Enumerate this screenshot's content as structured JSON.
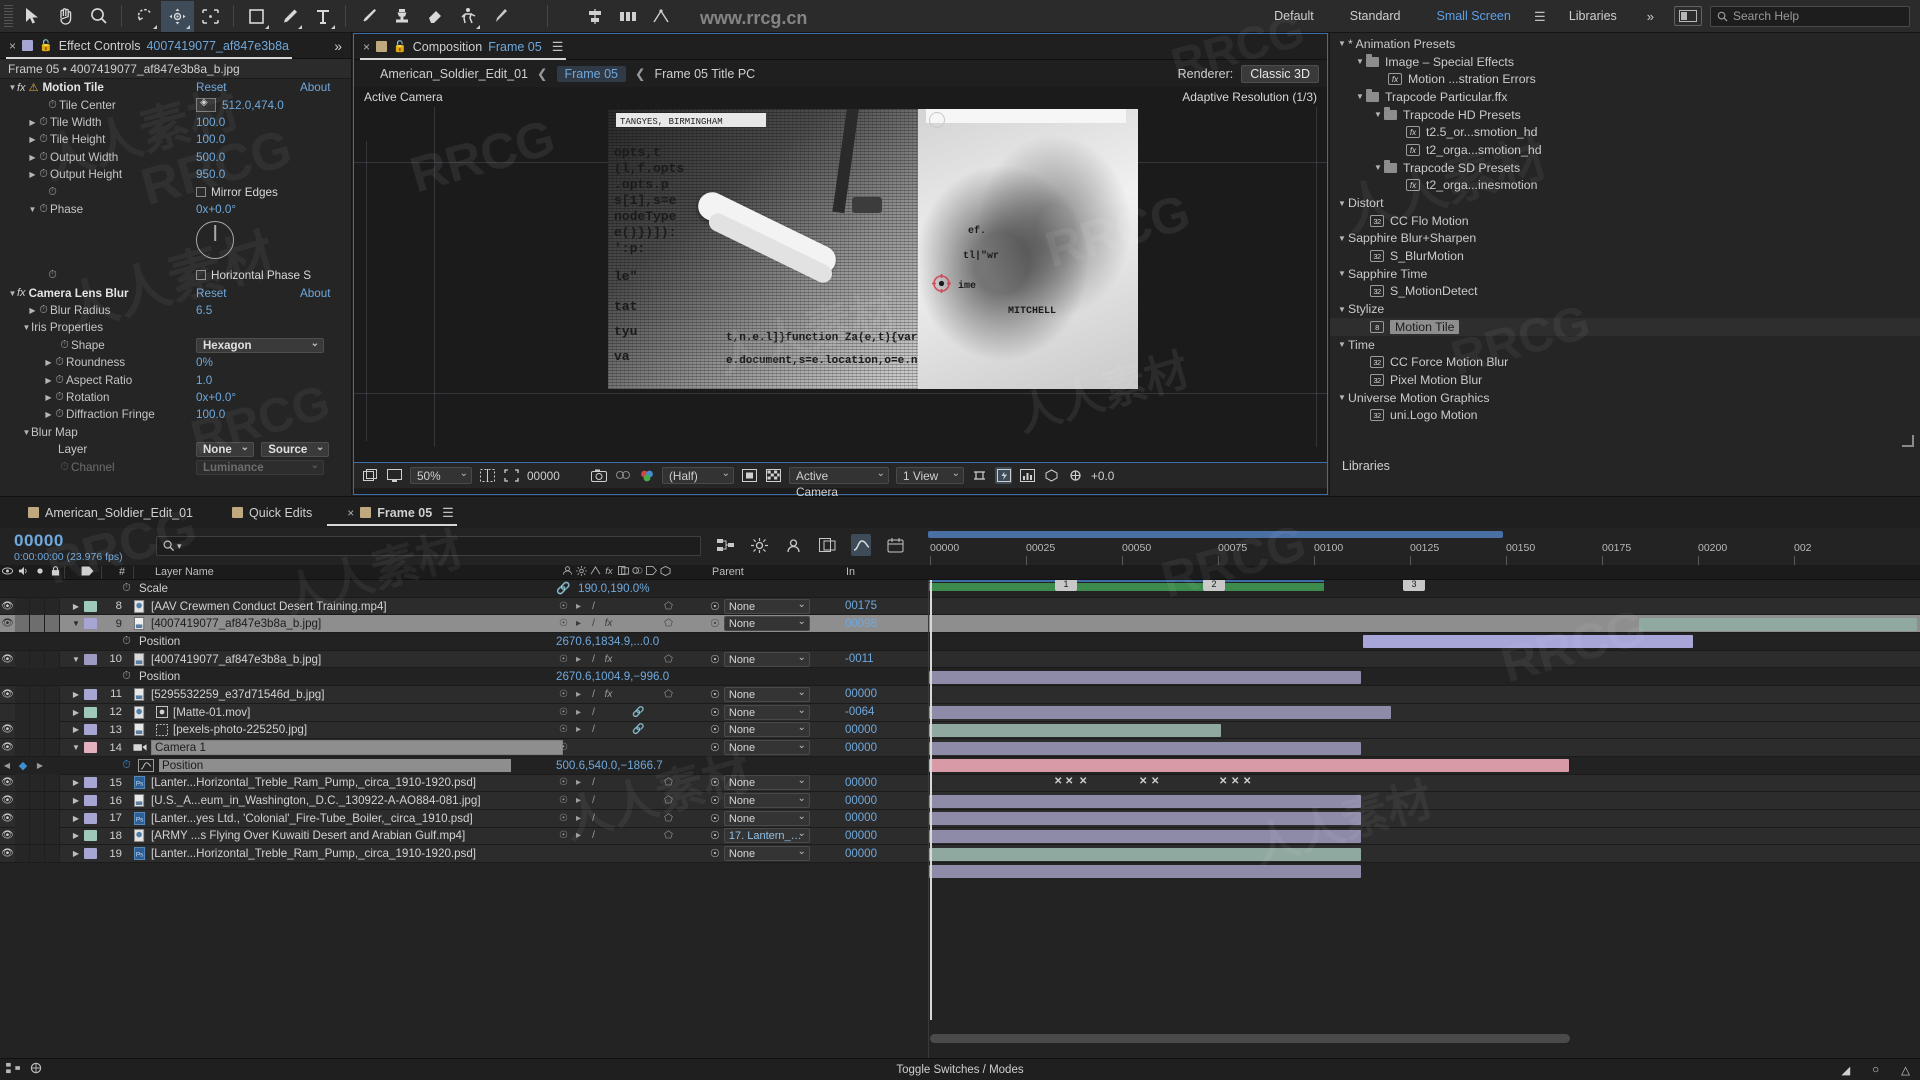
{
  "app": {
    "title": "Adobe After Effects"
  },
  "toolbar": {
    "tools": [
      {
        "name": "selection-tool",
        "label": "Selection",
        "selected": false
      },
      {
        "name": "hand-tool",
        "label": "Hand",
        "selected": false
      },
      {
        "name": "zoom-tool",
        "label": "Zoom",
        "selected": false
      },
      {
        "name": "orbit-tool",
        "label": "Orbit Camera",
        "selected": false
      },
      {
        "name": "unified-camera-tool",
        "label": "Unified Camera",
        "selected": true
      },
      {
        "name": "pan-behind-tool",
        "label": "Pan Behind (Anchor Point)",
        "selected": false
      },
      {
        "name": "rectangle-tool",
        "label": "Rectangle",
        "selected": false
      },
      {
        "name": "pen-tool",
        "label": "Pen",
        "selected": false
      },
      {
        "name": "type-tool",
        "label": "Type",
        "selected": false
      },
      {
        "name": "brush-tool",
        "label": "Brush",
        "selected": false
      },
      {
        "name": "clone-stamp-tool",
        "label": "Clone Stamp",
        "selected": false
      },
      {
        "name": "eraser-tool",
        "label": "Eraser",
        "selected": false
      },
      {
        "name": "roto-brush-tool",
        "label": "Roto Brush",
        "selected": false
      },
      {
        "name": "puppet-pin-tool",
        "label": "Puppet Pin",
        "selected": false
      }
    ],
    "extra_tools": [
      {
        "name": "align-tool",
        "label": "Align"
      },
      {
        "name": "distribute-tool",
        "label": "Distribute"
      },
      {
        "name": "snapping-tool",
        "label": "Snapping"
      }
    ],
    "workspaces": [
      {
        "label": "Default",
        "active": false
      },
      {
        "label": "Standard",
        "active": false
      },
      {
        "label": "Small Screen",
        "active": true
      },
      {
        "label": "Libraries",
        "active": false
      }
    ],
    "overflow_label": "»",
    "search_placeholder": "Search Help"
  },
  "effect_controls": {
    "tab_label": "Effect Controls",
    "tab_value": "4007419077_af847e3b8a",
    "overflow": "»",
    "header": "Frame 05  •  4007419077_af847e3b8a_b.jpg",
    "effects": [
      {
        "name": "Motion Tile",
        "reset": "Reset",
        "about": "About",
        "properties": [
          {
            "label": "Tile Center",
            "value": "512.0,474.0",
            "kind": "point"
          },
          {
            "label": "Tile Width",
            "value": "100.0",
            "kind": "number"
          },
          {
            "label": "Tile Height",
            "value": "100.0",
            "kind": "number"
          },
          {
            "label": "Output Width",
            "value": "500.0",
            "kind": "number"
          },
          {
            "label": "Output Height",
            "value": "950.0",
            "kind": "number"
          },
          {
            "label": "",
            "value": "Mirror Edges",
            "kind": "checkbox"
          },
          {
            "label": "Phase",
            "value": "0x+0.0°",
            "kind": "angle"
          },
          {
            "label": "",
            "value": "Horizontal Phase S",
            "kind": "checkbox"
          }
        ]
      },
      {
        "name": "Camera Lens Blur",
        "reset": "Reset",
        "about": "About",
        "properties": [
          {
            "label": "Blur Radius",
            "value": "6.5",
            "kind": "number"
          },
          {
            "label": "Iris Properties",
            "value": "",
            "kind": "group"
          },
          {
            "label": "Shape",
            "value": "Hexagon",
            "kind": "dropdown"
          },
          {
            "label": "Roundness",
            "value": "0%",
            "kind": "number"
          },
          {
            "label": "Aspect Ratio",
            "value": "1.0",
            "kind": "number"
          },
          {
            "label": "Rotation",
            "value": "0x+0.0°",
            "kind": "angle"
          },
          {
            "label": "Diffraction Fringe",
            "value": "100.0",
            "kind": "number"
          },
          {
            "label": "Blur Map",
            "value": "",
            "kind": "group"
          },
          {
            "label": "Layer",
            "value": "None",
            "value2": "Source",
            "kind": "layer-dropdown"
          },
          {
            "label": "Channel",
            "value": "Luminance",
            "kind": "dropdown-disabled"
          }
        ]
      }
    ]
  },
  "composition": {
    "tab_close": "×",
    "tab_prefix": "Composition",
    "tab_name": "Frame 05",
    "breadcrumbs": [
      {
        "label": "American_Soldier_Edit_01",
        "active": false
      },
      {
        "label": "Frame 05",
        "active": true
      },
      {
        "label": "Frame 05 Title PC",
        "active": false
      }
    ],
    "renderer_label": "Renderer:",
    "renderer_value": "Classic 3D",
    "active_camera": "Active Camera",
    "adaptive_resolution": "Adaptive Resolution (1/3)",
    "viewer": {
      "magnification": "50%",
      "timecode": "00000",
      "resolution": "(Half)",
      "view_camera": "Active Camera",
      "view_layout": "1 View",
      "exposure": "+0.0"
    },
    "image_text": {
      "top_label": "TANGYES, BIRMINGHAM",
      "bottom_label": "MITCHELL",
      "code_lines": [
        "opts,t",
        "(l,f.opts",
        ".opts.p",
        "s[1],s=e",
        "nodeType",
        "e()})]):",
        "':p:",
        "le\":",
        "tat",
        "tyu",
        "va"
      ],
      "code_lines_bottom": [
        "t,n.e.l]}function Za(e,t){var n",
        "e.document,s=e.location,o=e.nav"
      ]
    }
  },
  "effects_presets": {
    "panel_label": "Libraries",
    "tree": [
      {
        "depth": 0,
        "type": "group",
        "label": "* Animation Presets"
      },
      {
        "depth": 1,
        "type": "folder",
        "label": "Image – Special Effects"
      },
      {
        "depth": 2,
        "type": "preset",
        "label": "Motion ...stration Errors"
      },
      {
        "depth": 1,
        "type": "folder",
        "label": "Trapcode Particular.ffx"
      },
      {
        "depth": 2,
        "type": "folder",
        "label": "Trapcode HD Presets"
      },
      {
        "depth": 3,
        "type": "preset",
        "label": "t2.5_or...smotion_hd"
      },
      {
        "depth": 3,
        "type": "preset",
        "label": "t2_orga...smotion_hd"
      },
      {
        "depth": 2,
        "type": "folder",
        "label": "Trapcode SD Presets"
      },
      {
        "depth": 3,
        "type": "preset",
        "label": "t2_orga...inesmotion"
      },
      {
        "depth": 0,
        "type": "group",
        "label": "Distort"
      },
      {
        "depth": 1,
        "type": "effect",
        "badge": "32",
        "label": "CC Flo Motion"
      },
      {
        "depth": 0,
        "type": "group",
        "label": "Sapphire Blur+Sharpen"
      },
      {
        "depth": 1,
        "type": "effect",
        "badge": "32",
        "label": "S_BlurMotion"
      },
      {
        "depth": 0,
        "type": "group",
        "label": "Sapphire Time"
      },
      {
        "depth": 1,
        "type": "effect",
        "badge": "32",
        "label": "S_MotionDetect"
      },
      {
        "depth": 0,
        "type": "group",
        "label": "Stylize"
      },
      {
        "depth": 1,
        "type": "effect",
        "badge": "8",
        "label": "Motion Tile",
        "selected": true
      },
      {
        "depth": 0,
        "type": "group",
        "label": "Time"
      },
      {
        "depth": 1,
        "type": "effect",
        "badge": "32",
        "label": "CC Force Motion Blur"
      },
      {
        "depth": 1,
        "type": "effect",
        "badge": "32",
        "label": "Pixel Motion Blur"
      },
      {
        "depth": 0,
        "type": "group",
        "label": "Universe Motion Graphics"
      },
      {
        "depth": 1,
        "type": "effect",
        "badge": "32",
        "label": "uni.Logo Motion"
      }
    ]
  },
  "timeline": {
    "tabs": [
      {
        "label": "American_Soldier_Edit_01",
        "active": false,
        "closable": false
      },
      {
        "label": "Quick Edits",
        "active": false,
        "closable": false
      },
      {
        "label": "Frame 05",
        "active": true,
        "closable": true
      }
    ],
    "current_time_frames": "00000",
    "current_time_code": "0:00:00:00 (23.976 fps)",
    "search_placeholder": "",
    "columns": {
      "hash": "#",
      "layer_name": "Layer Name",
      "switches": "",
      "parent": "Parent",
      "in": "In"
    },
    "ruler_labels": [
      "00000",
      "00025",
      "00050",
      "00075",
      "00100",
      "00125",
      "00150",
      "00175",
      "00200",
      "002"
    ],
    "markers": [
      "1",
      "2",
      "3"
    ],
    "layers": [
      {
        "type": "prop",
        "indent": true,
        "label": "Scale",
        "value": "190.0,190.0%",
        "link": true
      },
      {
        "num": "8",
        "label": "[AAV Crewmen Conduct Desert Training.mp4]",
        "color": "#9ec8b9",
        "icon": "video-icon",
        "parent": "None",
        "in": "00175",
        "expanded": false,
        "visible": true,
        "bar": {
          "left": 0.72,
          "width": 0.28,
          "color": "#8fa9a0"
        }
      },
      {
        "num": "9",
        "label": "[4007419077_af847e3b8a_b.jpg]",
        "color": "#a7a5d4",
        "icon": "image-icon",
        "parent": "None",
        "in": "00098",
        "expanded": true,
        "visible": true,
        "selected": true,
        "fx": true,
        "bar": {
          "left": 0.435,
          "width": 0.33,
          "color": "#a8a6d8"
        }
      },
      {
        "type": "prop",
        "label": "Position",
        "value": "2670.6,1834.9,...0.0"
      },
      {
        "num": "10",
        "label": "[4007419077_af847e3b8a_b.jpg]",
        "color": "#a7a5d4",
        "icon": "image-icon",
        "parent": "None",
        "in": "-0011",
        "expanded": true,
        "visible": true,
        "fx": true,
        "bar": {
          "left": 0.0,
          "width": 0.435,
          "color": "#8d8ba8"
        }
      },
      {
        "type": "prop",
        "label": "Position",
        "value": "2670.6,1004.9,−996.0"
      },
      {
        "num": "11",
        "label": "[5295532259_e37d71546d_b.jpg]",
        "color": "#a7a5d4",
        "icon": "image-icon",
        "parent": "None",
        "in": "00000",
        "expanded": false,
        "visible": true,
        "fx": true,
        "bar": {
          "left": 0.0,
          "width": 0.48,
          "color": "#8d8ba8"
        }
      },
      {
        "num": "12",
        "label": "[Matte-01.mov]",
        "color": "#9ec8b9",
        "icon": "video-icon",
        "parent": "None",
        "in": "-0064",
        "expanded": false,
        "visible": false,
        "bar": {
          "left": 0.0,
          "width": 0.3,
          "color": "#8fa9a0"
        }
      },
      {
        "num": "13",
        "label": "[pexels-photo-225250.jpg]",
        "color": "#a7a5d4",
        "icon": "image-icon",
        "parent": "None",
        "in": "00000",
        "expanded": false,
        "visible": true,
        "bar": {
          "left": 0.0,
          "width": 0.44,
          "color": "#8d8ba8"
        }
      },
      {
        "num": "14",
        "label": "Camera 1",
        "color": "#e3b0bd",
        "icon": "camera-icon",
        "parent": "None",
        "in": "00000",
        "expanded": true,
        "visible": true,
        "selected_name": true,
        "bar": {
          "left": 0.0,
          "width": 0.8,
          "color": "#d99aa8"
        }
      },
      {
        "type": "prop",
        "label": "Position",
        "value": "500.6,540.0,−1866.7",
        "keyframes": true,
        "kf_marks": [
          0.215,
          0.235,
          0.25,
          0.32,
          0.335,
          0.44,
          0.455,
          0.47
        ]
      },
      {
        "num": "15",
        "label": "[Lanter...Horizontal_Treble_Ram_Pump,_circa_1910-1920.psd]",
        "color": "#a7a5d4",
        "icon": "psd-icon",
        "parent": "None",
        "in": "00000",
        "expanded": false,
        "visible": true,
        "bar": {
          "left": 0.0,
          "width": 0.48,
          "color": "#8d8ba8"
        }
      },
      {
        "num": "16",
        "label": "[U.S._A...eum_in_Washington,_D.C._130922-A-AO884-081.jpg]",
        "color": "#a7a5d4",
        "icon": "image-icon",
        "parent": "None",
        "in": "00000",
        "expanded": false,
        "visible": true,
        "bar": {
          "left": 0.0,
          "width": 0.48,
          "color": "#8d8ba8"
        }
      },
      {
        "num": "17",
        "label": "[Lanter...yes Ltd., 'Colonial'_Fire-Tube_Boiler,_circa_1910.psd]",
        "color": "#a7a5d4",
        "icon": "psd-icon",
        "parent": "None",
        "in": "00000",
        "expanded": false,
        "visible": true,
        "bar": {
          "left": 0.0,
          "width": 0.48,
          "color": "#8d8ba8"
        }
      },
      {
        "num": "18",
        "label": "[ARMY ...s Flying Over Kuwaiti Desert and Arabian Gulf.mp4]",
        "color": "#9ec8b9",
        "icon": "video-icon",
        "parent": "17. Lantern_…",
        "in": "00000",
        "expanded": false,
        "visible": true,
        "bar": {
          "left": 0.0,
          "width": 0.48,
          "color": "#8fa9a0"
        }
      },
      {
        "num": "19",
        "label": "[Lanter...Horizontal_Treble_Ram_Pump,_circa_1910-1920.psd]",
        "color": "#a7a5d4",
        "icon": "psd-icon",
        "parent": "None",
        "in": "00000",
        "expanded": false,
        "visible": true,
        "bar": {
          "left": 0.0,
          "width": 0.48,
          "color": "#8d8ba8"
        }
      }
    ],
    "footer_label": "Toggle Switches / Modes"
  },
  "watermarks": {
    "site": "www.rrcg.cn",
    "brand": "RRCG",
    "cn": "人人素材"
  },
  "colors": {
    "accent_blue": "#6fa8dc",
    "panel_bg": "#252525",
    "selected_blue": "#3e4c59",
    "highlight_border": "#3c6ea5"
  }
}
